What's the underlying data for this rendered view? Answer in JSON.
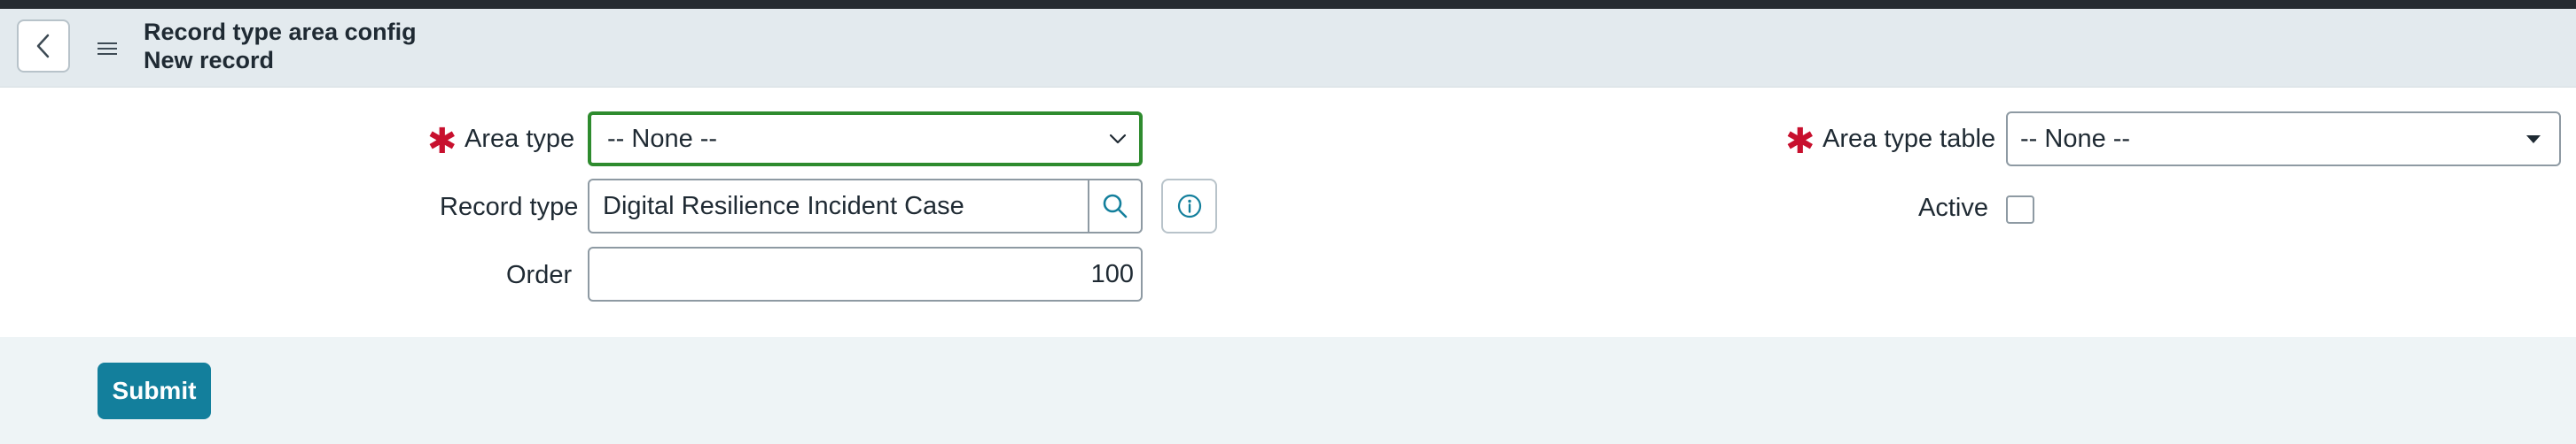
{
  "header": {
    "title_line1": "Record type area config",
    "title_line2": "New record",
    "back_icon": "chevron-left-icon",
    "menu_icon": "hamburger-menu-icon"
  },
  "form": {
    "area_type": {
      "label": "Area type",
      "required": true,
      "value": "-- None --"
    },
    "record_type": {
      "label": "Record type",
      "value": "Digital Resilience Incident Case"
    },
    "order": {
      "label": "Order",
      "value": "100"
    },
    "area_type_table": {
      "label": "Area type table",
      "required": true,
      "value": "-- None --"
    },
    "active": {
      "label": "Active",
      "checked": false
    }
  },
  "footer": {
    "submit_label": "Submit"
  },
  "colors": {
    "required": "#c8102e",
    "focus_border": "#2e8b2e",
    "primary_button": "#137f9c",
    "header_bg": "#e3eaee"
  }
}
